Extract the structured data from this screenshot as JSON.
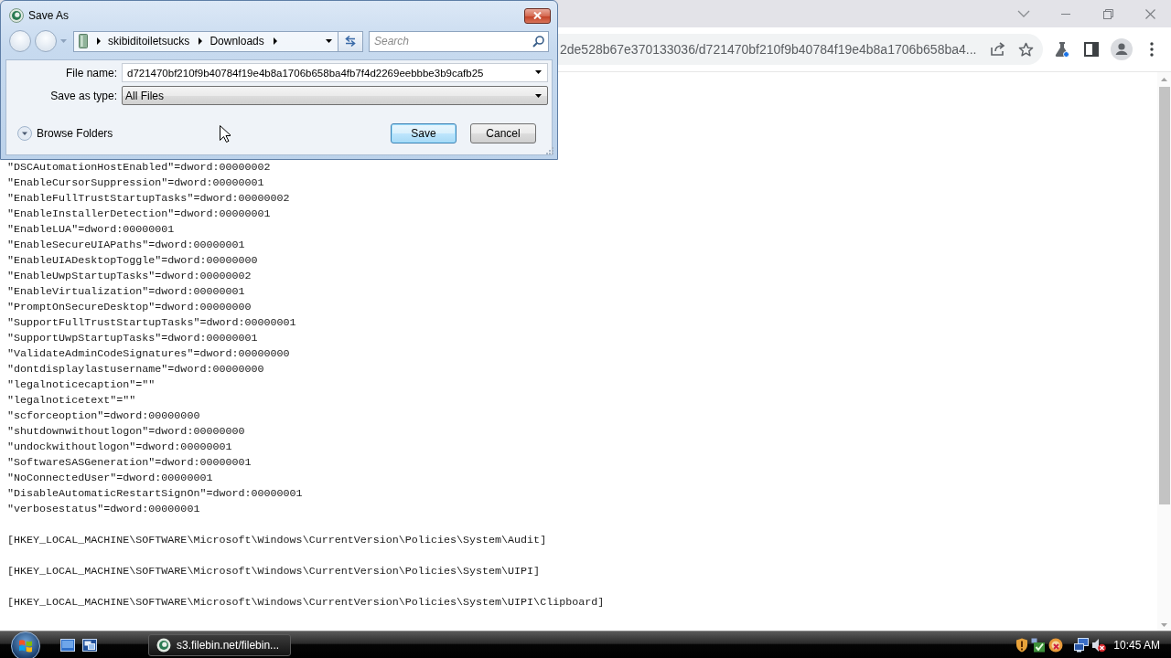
{
  "dialog": {
    "title": "Save As",
    "breadcrumb": [
      "skibiditoiletsucks",
      "Downloads"
    ],
    "search": {
      "placeholder": "Search"
    },
    "fields": [
      {
        "kind": "combo",
        "label": "File name:",
        "value": "d721470bf210f9b40784f19e4b8a1706b658ba4fb7f4d2269eebbbe3b9cafb25"
      },
      {
        "kind": "select",
        "label": "Save as type:",
        "value": "All Files"
      }
    ],
    "browse_folders": "Browse Folders",
    "buttons": [
      {
        "label": "Save",
        "default": true
      },
      {
        "label": "Cancel",
        "default": false
      }
    ]
  },
  "browser": {
    "address": "2de528b67e370133036/d721470bf210f9b40784f19e4b8a1706b658ba4...",
    "page_lines": [
      {
        "kind": "value",
        "text": "\"DSCAutomationHostEnabled\"=dword:00000002"
      },
      {
        "kind": "value",
        "text": "\"EnableCursorSuppression\"=dword:00000001"
      },
      {
        "kind": "value",
        "text": "\"EnableFullTrustStartupTasks\"=dword:00000002"
      },
      {
        "kind": "value",
        "text": "\"EnableInstallerDetection\"=dword:00000001"
      },
      {
        "kind": "value",
        "text": "\"EnableLUA\"=dword:00000001"
      },
      {
        "kind": "value",
        "text": "\"EnableSecureUIAPaths\"=dword:00000001"
      },
      {
        "kind": "value",
        "text": "\"EnableUIADesktopToggle\"=dword:00000000"
      },
      {
        "kind": "value",
        "text": "\"EnableUwpStartupTasks\"=dword:00000002"
      },
      {
        "kind": "value",
        "text": "\"EnableVirtualization\"=dword:00000001"
      },
      {
        "kind": "value",
        "text": "\"PromptOnSecureDesktop\"=dword:00000000"
      },
      {
        "kind": "value",
        "text": "\"SupportFullTrustStartupTasks\"=dword:00000001"
      },
      {
        "kind": "value",
        "text": "\"SupportUwpStartupTasks\"=dword:00000001"
      },
      {
        "kind": "value",
        "text": "\"ValidateAdminCodeSignatures\"=dword:00000000"
      },
      {
        "kind": "value",
        "text": "\"dontdisplaylastusername\"=dword:00000000"
      },
      {
        "kind": "value",
        "text": "\"legalnoticecaption\"=\"\""
      },
      {
        "kind": "value",
        "text": "\"legalnoticetext\"=\"\""
      },
      {
        "kind": "value",
        "text": "\"scforceoption\"=dword:00000000"
      },
      {
        "kind": "value",
        "text": "\"shutdownwithoutlogon\"=dword:00000000"
      },
      {
        "kind": "value",
        "text": "\"undockwithoutlogon\"=dword:00000001"
      },
      {
        "kind": "value",
        "text": "\"SoftwareSASGeneration\"=dword:00000001"
      },
      {
        "kind": "value",
        "text": "\"NoConnectedUser\"=dword:00000001"
      },
      {
        "kind": "value",
        "text": "\"DisableAutomaticRestartSignOn\"=dword:00000001"
      },
      {
        "kind": "value",
        "text": "\"verbosestatus\"=dword:00000001"
      },
      {
        "kind": "key",
        "text": "[HKEY_LOCAL_MACHINE\\SOFTWARE\\Microsoft\\Windows\\CurrentVersion\\Policies\\System\\Audit]"
      },
      {
        "kind": "key",
        "text": "[HKEY_LOCAL_MACHINE\\SOFTWARE\\Microsoft\\Windows\\CurrentVersion\\Policies\\System\\UIPI]"
      },
      {
        "kind": "key",
        "text": "[HKEY_LOCAL_MACHINE\\SOFTWARE\\Microsoft\\Windows\\CurrentVersion\\Policies\\System\\UIPI\\Clipboard]"
      }
    ]
  },
  "taskbar": {
    "task_button": "s3.filebin.net/filebin...",
    "clock": "10:45 AM"
  }
}
